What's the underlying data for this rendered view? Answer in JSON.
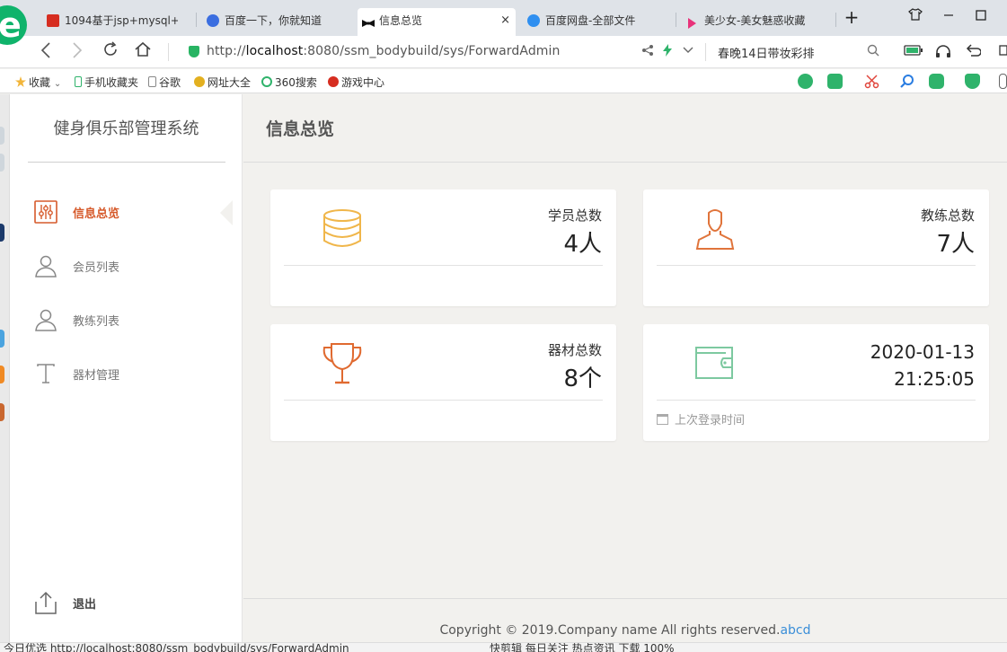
{
  "browser": {
    "tabs": [
      {
        "label": "1094基于jsp+mysql+",
        "color": "#d62d20"
      },
      {
        "label": "百度一下，你就知道",
        "color": "#3b6ee0"
      },
      {
        "label": "信息总览",
        "color": "#111111"
      },
      {
        "label": "百度网盘-全部文件",
        "color": "#2f8ff0"
      },
      {
        "label": "美少女-美女魅惑收藏",
        "color": "#e8327a"
      }
    ],
    "active_tab_close": "×",
    "new_tab": "+",
    "url_prefix": "http://",
    "url_host": "localhost",
    "url_rest": ":8080/ssm_bodybuild/sys/ForwardAdmin",
    "search_text": "春晚14日带妆彩排",
    "bookmarks": [
      "收藏",
      "手机收藏夹",
      "谷歌",
      "网址大全",
      "360搜索",
      "游戏中心"
    ]
  },
  "sidebar": {
    "system_title": "健身俱乐部管理系统",
    "items": [
      {
        "label": "信息总览",
        "icon": "sliders-icon",
        "active": true
      },
      {
        "label": "会员列表",
        "icon": "user-icon",
        "active": false
      },
      {
        "label": "教练列表",
        "icon": "user-icon",
        "active": false
      },
      {
        "label": "器材管理",
        "icon": "text-t-icon",
        "active": false
      }
    ],
    "logout_label": "退出"
  },
  "main": {
    "title": "信息总览",
    "cards": {
      "members": {
        "label": "学员总数",
        "value": "4人",
        "icon": "coins-icon",
        "icon_color": "#f0b64a"
      },
      "coaches": {
        "label": "教练总数",
        "value": "7人",
        "icon": "person-icon",
        "icon_color": "#e0743b"
      },
      "equipment": {
        "label": "器材总数",
        "value": "8个",
        "icon": "trophy-icon",
        "icon_color": "#e06a30"
      },
      "last_login": {
        "date": "2020-01-13",
        "time": "21:25:05",
        "caption": "上次登录时间",
        "icon": "wallet-icon",
        "icon_color": "#7dc9a0"
      }
    }
  },
  "footer": {
    "copyright": "Copyright © 2019.Company name All rights reserved.",
    "link": "abcd"
  },
  "statusbar": {
    "left": "今日优选  http://localhost:8080/ssm_bodybuild/sys/ForwardAdmin",
    "right": "快剪辑   每日关注   热点资讯        下载              100%"
  },
  "colors": {
    "accent": "#d65a2b",
    "page_bg": "#f2f1ee",
    "link": "#3a8ed8"
  }
}
